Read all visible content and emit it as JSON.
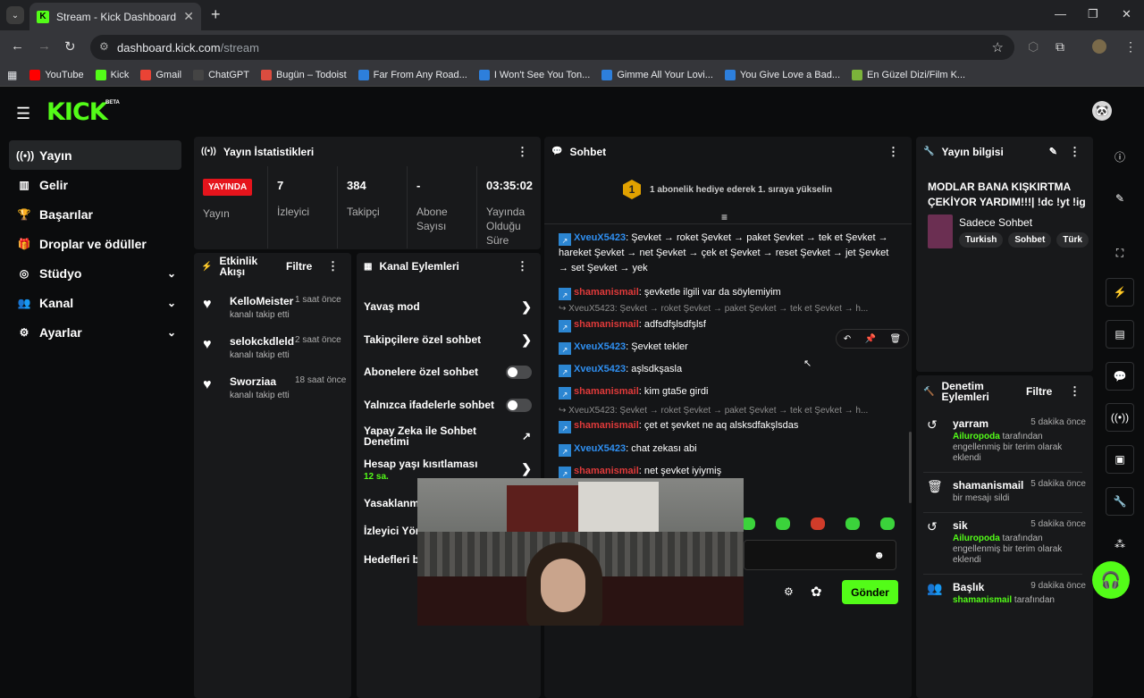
{
  "browser": {
    "tab_title": "Stream - Kick Dashboard",
    "url_host": "dashboard.kick.com",
    "url_path": "/stream",
    "bookmarks": [
      {
        "label": "YouTube",
        "color": "#ff0000",
        "icon": "youtube-icon"
      },
      {
        "label": "Kick",
        "color": "#53fc18",
        "icon": "kick-icon"
      },
      {
        "label": "Gmail",
        "color": "#ea4335",
        "icon": "gmail-icon"
      },
      {
        "label": "ChatGPT",
        "color": "#444444",
        "icon": "chatgpt-icon"
      },
      {
        "label": "Bugün – Todoist",
        "color": "#db4c3f",
        "icon": "todoist-icon"
      },
      {
        "label": "Far From Any Road...",
        "color": "#2d7fdc",
        "icon": "page-icon"
      },
      {
        "label": "I Won't See You Ton...",
        "color": "#2d7fdc",
        "icon": "page-icon"
      },
      {
        "label": "Gimme All Your Lovi...",
        "color": "#2d7fdc",
        "icon": "page-icon"
      },
      {
        "label": "You Give Love a Bad...",
        "color": "#2d7fdc",
        "icon": "page-icon"
      },
      {
        "label": "En Güzel Dizi/Film K...",
        "color": "#7bb33a",
        "icon": "page-icon"
      }
    ]
  },
  "app": {
    "logo": "KICK",
    "beta": "BETA",
    "accent": "#53fc18",
    "sidebar": [
      {
        "label": "Yayın",
        "icon": "broadcast-icon",
        "glyph": "((•))",
        "active": true,
        "chevron": false
      },
      {
        "label": "Gelir",
        "icon": "revenue-icon",
        "glyph": "▥",
        "active": false,
        "chevron": false
      },
      {
        "label": "Başarılar",
        "icon": "trophy-icon",
        "glyph": "🏆",
        "active": false,
        "chevron": false
      },
      {
        "label": "Droplar ve ödüller",
        "icon": "gift-icon",
        "glyph": "🎁",
        "active": false,
        "chevron": false
      },
      {
        "label": "Stüdyo",
        "icon": "studio-icon",
        "glyph": "◎",
        "active": false,
        "chevron": true
      },
      {
        "label": "Kanal",
        "icon": "users-icon",
        "glyph": "👥",
        "active": false,
        "chevron": true
      },
      {
        "label": "Ayarlar",
        "icon": "gear-icon",
        "glyph": "⚙",
        "active": false,
        "chevron": true
      }
    ]
  },
  "stats": {
    "title": "Yayın İstatistikleri",
    "live_label": "YAYINDA",
    "status_label": "Yayın",
    "items": [
      {
        "value": "7",
        "label": "İzleyici"
      },
      {
        "value": "384",
        "label": "Takipçi"
      },
      {
        "value": "-",
        "label": "Abone Sayısı"
      },
      {
        "value": "03:35:02",
        "label": "Yayında Olduğu Süre"
      }
    ]
  },
  "activity": {
    "title": "Etkinlik Akışı",
    "filter": "Filtre",
    "items": [
      {
        "name": "KelloMeister",
        "time": "1 saat önce",
        "desc": "kanalı takip etti"
      },
      {
        "name": "selokckdleld",
        "time": "2 saat önce",
        "desc": "kanalı takip etti"
      },
      {
        "name": "Sworziaa",
        "time": "18 saat önce",
        "desc": "kanalı takip etti"
      }
    ]
  },
  "channel_actions": {
    "title": "Kanal Eylemleri",
    "slow_mode": "Yavaş mod",
    "followers_only": "Takipçilere özel sohbet",
    "subs_only": "Abonelere özel sohbet",
    "emotes_only": "Yalnızca ifadelerle sohbet",
    "ai_moderation": "Yapay Zeka ile Sohbet Denetimi",
    "account_age": "Hesap yaşı kısıtlaması",
    "account_age_value": "12 sa.",
    "banned": "Yasaklanm",
    "viewers": "İzleyici Yön",
    "goals": "Hedefleri b"
  },
  "chat": {
    "title": "Sohbet",
    "banner_num": "1",
    "banner_text": "1 abonelik hediye ederek 1. sıraya yükselin",
    "send_label": "Gönder",
    "messages": [
      {
        "type": "msg",
        "user": "XveuX5423",
        "color": "u1",
        "text": "Şevket → roket Şevket → paket Şevket → tek et Şevket → hareket Şevket → net Şevket → çek et Şevket → reset Şevket → jet Şevket → set Şevket → yek"
      },
      {
        "type": "msg",
        "user": "shamanismail",
        "color": "u2",
        "text": "şevketle ilgili var da söylemiyim"
      },
      {
        "type": "reply",
        "text": "↪ XveuX5423: Şevket → roket Şevket → paket Şevket → tek et Şevket → h..."
      },
      {
        "type": "msg",
        "user": "shamanismail",
        "color": "u2",
        "text": "adfsdfşlsdfşlsf"
      },
      {
        "type": "msg",
        "user": "XveuX5423",
        "color": "u1",
        "text": "Şevket tekler"
      },
      {
        "type": "msg",
        "user": "XveuX5423",
        "color": "u1",
        "text": "aşlsdkşasla"
      },
      {
        "type": "msg",
        "user": "shamanismail",
        "color": "u2",
        "text": "kim gta5e girdi"
      },
      {
        "type": "reply",
        "text": "↪ XveuX5423: Şevket → roket Şevket → paket Şevket → tek et Şevket → h..."
      },
      {
        "type": "msg",
        "user": "shamanismail",
        "color": "u2",
        "text": "çet et şevket ne aq alsksdfakşlsdas"
      },
      {
        "type": "msg",
        "user": "XveuX5423",
        "color": "u1",
        "text": "chat zekası abi"
      },
      {
        "type": "msg",
        "user": "shamanismail",
        "color": "u2",
        "text": "net şevket iyiymiş"
      }
    ]
  },
  "stream_info": {
    "title": "Yayın bilgisi",
    "stream_title": "MODLAR BANA KIŞKIRTMA ÇEKİYOR YARDIM!!!| !dc !yt !ig",
    "category": "Sadece Sohbet",
    "tags": [
      "Turkish",
      "Sohbet",
      "Türk"
    ]
  },
  "moderation": {
    "title": "Denetim Eylemleri",
    "filter": "Filtre",
    "items": [
      {
        "icon": "undo-icon",
        "glyph": "↺",
        "name": "yarram",
        "time": "5 dakika önce",
        "actor": "Ailuropoda",
        "desc": " tarafından engellenmiş bir terim olarak eklendi"
      },
      {
        "icon": "trash-icon",
        "glyph": "🗑",
        "name": "shamanismail",
        "time": "5 dakika önce",
        "actor": "",
        "desc": "bir mesajı sildi"
      },
      {
        "icon": "undo-icon",
        "glyph": "↺",
        "name": "sik",
        "time": "5 dakika önce",
        "actor": "Ailuropoda",
        "desc": " tarafından engellenmiş bir terim olarak eklendi"
      },
      {
        "icon": "users-icon",
        "glyph": "👥",
        "name": "Başlık",
        "time": "9 dakika önce",
        "actor": "shamanismail",
        "desc": " tarafından"
      }
    ]
  }
}
